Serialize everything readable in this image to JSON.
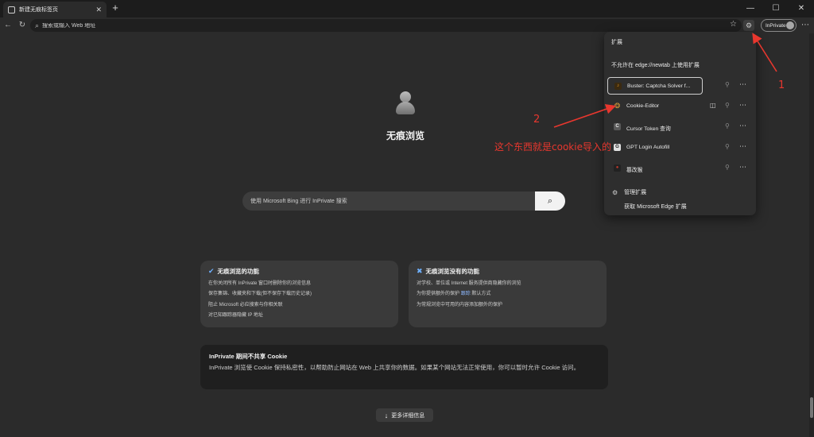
{
  "browser": {
    "tab_title": "新建无痕标签页",
    "address_placeholder": "搜索或输入 Web 地址",
    "profile_label": "InPrivate"
  },
  "page": {
    "heading": "无痕浏览",
    "search_placeholder": "使用 Microsoft Bing 进行 InPrivate 搜索",
    "does_card": {
      "title": "无痕浏览的功能",
      "lines": [
        "在你关闭所有 InPrivate 窗口时删除你的浏览信息",
        "保存集锦、收藏夹和下载(但不保存下载历史记录)",
        "阻止 Microsoft 必应搜索与你相关联",
        "对已知跟踪器隐藏 IP 地址"
      ]
    },
    "doesnt_card": {
      "title": "无痕浏览没有的功能",
      "lines": [
        "对学校、单位或 Internet 服务提供商隐藏你的浏览",
        "为你提供额外的保护",
        "默认方式",
        "为常规浏览中可用的内容添加额外的保护"
      ],
      "link_text": "跟踪"
    },
    "cookie_card": {
      "title": "InPrivate 期间不共享 Cookie",
      "body": "InPrivate 浏览使 Cookie 保持私密性，以帮助防止网站在 Web 上共享你的数据。如果某个网站无法正常使用，你可以暂时允许 Cookie 访问。"
    },
    "more_info": "更多详细信息"
  },
  "extensions_panel": {
    "title": "扩展",
    "notice": "不允许在 edge://newtab 上使用扩展",
    "items": [
      {
        "name": "Buster: Captcha Solver f...",
        "icon": "buster-icon",
        "icon_color": "#f0a020"
      },
      {
        "name": "Cookie-Editor",
        "icon": "cookie-icon",
        "icon_color": "#d39a3a"
      },
      {
        "name": "Cursor Token 查询",
        "icon": "c-letter-icon",
        "icon_color": "#9a9a9a"
      },
      {
        "name": "GPT Login Autofill",
        "icon": "gpt-icon",
        "icon_color": "#cfcfcf"
      },
      {
        "name": "篡改猴",
        "icon": "tampermonkey-icon",
        "icon_color": "#c0392b"
      }
    ],
    "manage_label": "管理扩展",
    "get_label": "获取 Microsoft Edge 扩展"
  },
  "annotations": {
    "label_1": "1",
    "label_2": "2",
    "note": "这个东西就是cookie导入的",
    "color": "#e8372e"
  }
}
